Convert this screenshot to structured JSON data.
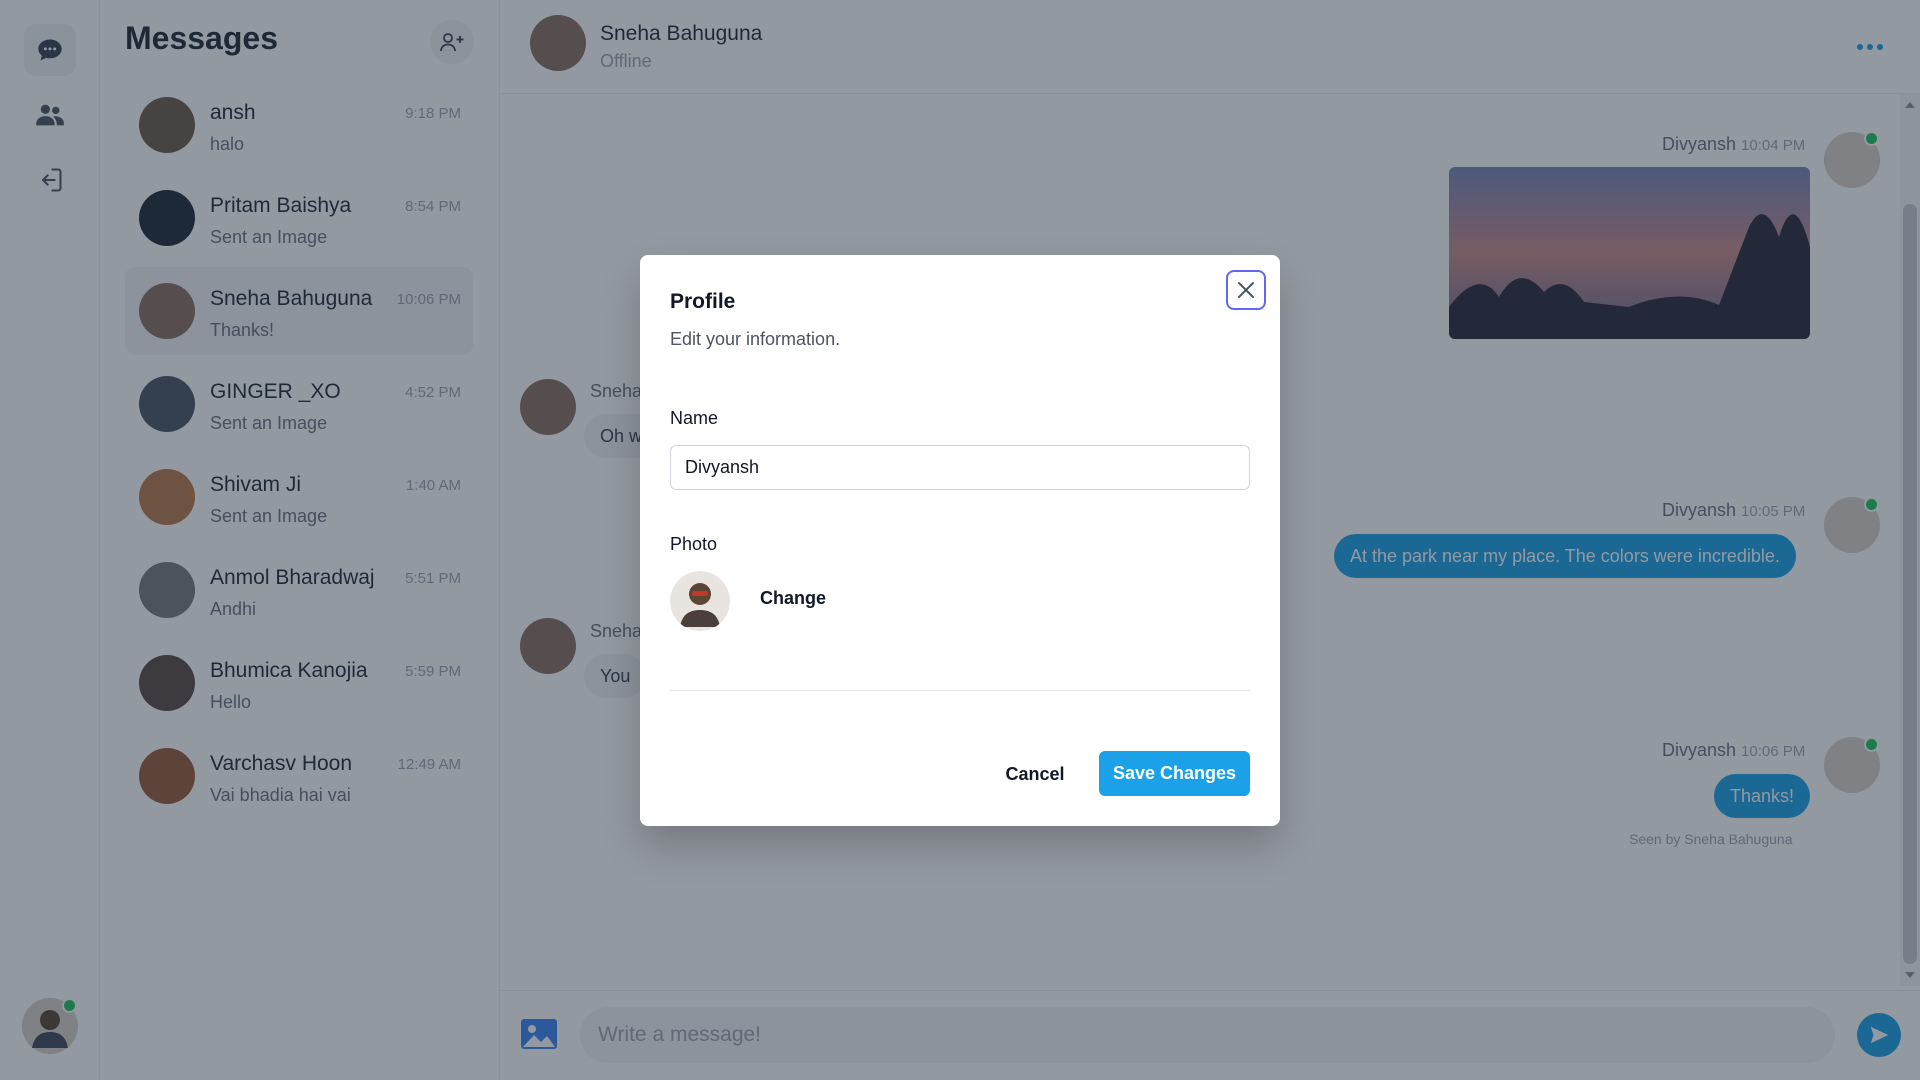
{
  "sidebar_nav": {
    "items": [
      {
        "icon": "chat-bubble-icon",
        "active": true
      },
      {
        "icon": "users-icon",
        "active": false
      },
      {
        "icon": "logout-icon",
        "active": false
      }
    ],
    "user_online": true
  },
  "conversations": {
    "title": "Messages",
    "add_icon": "add-user-icon",
    "items": [
      {
        "name": "ansh",
        "time": "9:18 PM",
        "preview": "halo",
        "avatar_color": "#6b5a4a"
      },
      {
        "name": "Pritam Baishya",
        "time": "8:54 PM",
        "preview": "Sent an Image",
        "avatar_color": "#1f2937"
      },
      {
        "name": "Sneha Bahuguna",
        "time": "10:06 PM",
        "preview": "Thanks!",
        "avatar_color": "#8a7060",
        "selected": true
      },
      {
        "name": "GINGER _XO",
        "time": "4:52 PM",
        "preview": "Sent an Image",
        "avatar_color": "#4b5563"
      },
      {
        "name": "Shivam Ji",
        "time": "1:40 AM",
        "preview": "Sent an Image",
        "avatar_color": "#b8794a"
      },
      {
        "name": "Anmol Bharadwaj",
        "time": "5:51 PM",
        "preview": "Andhi",
        "avatar_color": "#7a7a7a"
      },
      {
        "name": "Bhumica Kanojia",
        "time": "5:59 PM",
        "preview": "Hello",
        "avatar_color": "#5a4a45"
      },
      {
        "name": "Varchasv Hoon",
        "time": "12:49 AM",
        "preview": "Vai bhadia hai vai",
        "avatar_color": "#9a5a3a"
      }
    ]
  },
  "chat": {
    "contact_name": "Sneha Bahuguna",
    "contact_status": "Offline",
    "messages": [
      {
        "sender": "Divyansh",
        "time": "10:04 PM",
        "type": "image"
      },
      {
        "sender": "Sneha",
        "text": "Oh w",
        "type": "incoming"
      },
      {
        "sender": "Divyansh",
        "time": "10:05 PM",
        "text": "At the park near my place. The colors were incredible.",
        "type": "outgoing"
      },
      {
        "sender": "Sneha",
        "text": "You",
        "type": "incoming"
      },
      {
        "sender": "Divyansh",
        "time": "10:06 PM",
        "text": "Thanks!",
        "type": "outgoing"
      }
    ],
    "seen_text": "Seen by Sneha Bahuguna",
    "composer_placeholder": "Write a message!"
  },
  "modal": {
    "title": "Profile",
    "subtitle": "Edit your information.",
    "name_label": "Name",
    "name_value": "Divyansh",
    "photo_label": "Photo",
    "change_label": "Change",
    "cancel_label": "Cancel",
    "save_label": "Save Changes"
  },
  "colors": {
    "accent": "#1aa1e8",
    "online": "#22c55e",
    "focus_ring": "#6366f1"
  }
}
